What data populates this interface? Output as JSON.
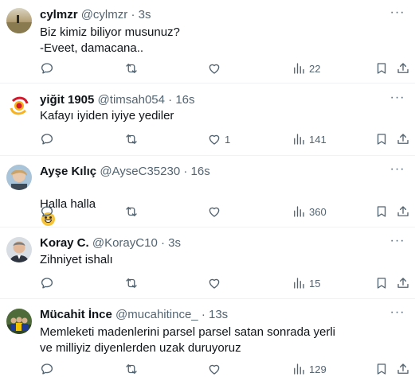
{
  "tweets": [
    {
      "name": "cylmzr",
      "handle": "@cylmzr",
      "sep": "·",
      "time": "3s",
      "text": "Biz kimiz biliyor musunuz?\n-Eveet, damacana..",
      "stats": {
        "replies": "",
        "retweets": "",
        "likes": "",
        "views": "22"
      }
    },
    {
      "name": "yiğit 1905",
      "handle": "@timsah054",
      "sep": "·",
      "time": "16s",
      "text": "Kafayı iyiden iyiye yediler",
      "stats": {
        "replies": "",
        "retweets": "",
        "likes": "1",
        "views": "141"
      }
    },
    {
      "name": "Ayşe Kılıç",
      "handle": "@AyseC35230",
      "sep": "·",
      "time": "16s",
      "text": "Halla halla",
      "stats": {
        "replies": "",
        "retweets": "",
        "likes": "",
        "views": "360"
      }
    },
    {
      "name": "Koray C.",
      "handle": "@KorayC10",
      "sep": "·",
      "time": "3s",
      "text": "Zihniyet ishalı",
      "stats": {
        "replies": "",
        "retweets": "",
        "likes": "",
        "views": "15"
      }
    },
    {
      "name": "Mücahit İnce",
      "handle": "@mucahitince_",
      "sep": "·",
      "time": "13s",
      "text": "Memleketi madenlerini parsel parsel satan sonrada yerli ve milliyiz diyenlerden uzak duruyoruz",
      "stats": {
        "replies": "",
        "retweets": "",
        "likes": "",
        "views": "129"
      }
    }
  ],
  "more_glyph": "···",
  "icons": [
    "reply-icon",
    "retweet-icon",
    "like-icon",
    "views-icon",
    "bookmark-icon",
    "share-icon"
  ],
  "colors": {
    "text": "#0f1419",
    "secondary": "#536471",
    "divider": "#eff3f4"
  }
}
